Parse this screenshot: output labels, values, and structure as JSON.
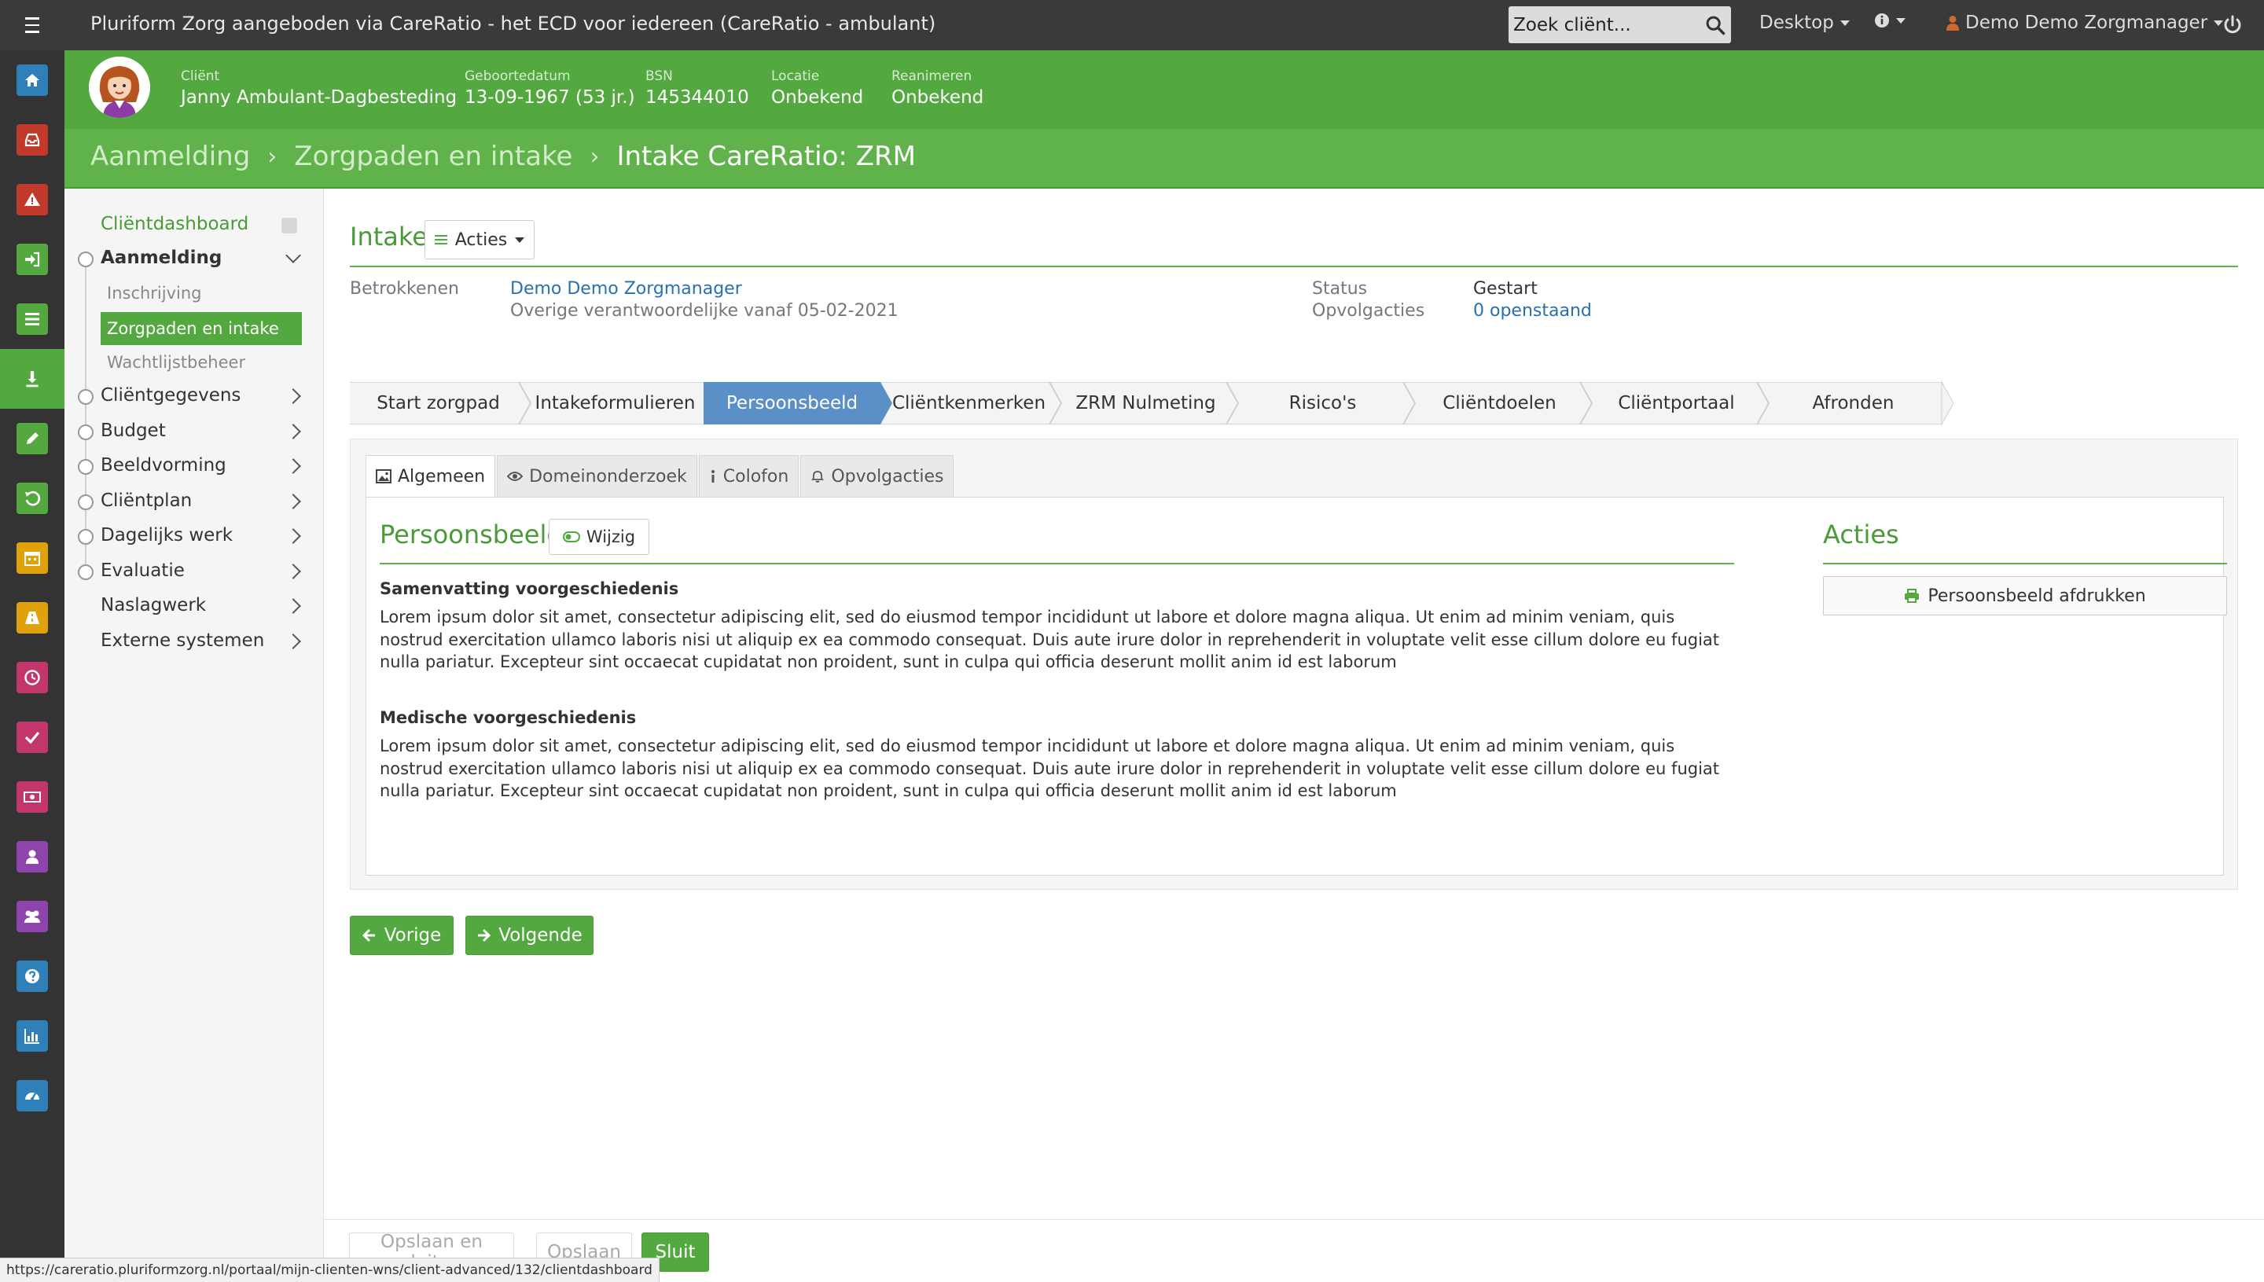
{
  "app": {
    "title": "Pluriform Zorg aangeboden via CareRatio - het ECD voor iedereen  (CareRatio - ambulant)"
  },
  "topbar": {
    "search_placeholder": "Zoek cliënt...",
    "desktop_label": "Desktop",
    "user_label": "Demo Demo Zorgmanager"
  },
  "rail": {
    "items": [
      {
        "icon": "home-icon",
        "color": "#2f7fb8"
      },
      {
        "icon": "inbox-icon",
        "color": "#c0392b"
      },
      {
        "icon": "warning-icon",
        "color": "#c0392b"
      },
      {
        "icon": "sign-in-icon",
        "color": "#53a83f"
      },
      {
        "icon": "list-icon",
        "color": "#53a83f"
      },
      {
        "icon": "client-icon",
        "color": "#53a83f",
        "active": true
      },
      {
        "icon": "pencil-icon",
        "color": "#53a83f"
      },
      {
        "icon": "refresh-icon",
        "color": "#53a83f"
      },
      {
        "icon": "calendar-icon",
        "color": "#e0a10b"
      },
      {
        "icon": "road-icon",
        "color": "#e0a10b"
      },
      {
        "icon": "clock-icon",
        "color": "#c2366b"
      },
      {
        "icon": "check-icon",
        "color": "#c2366b"
      },
      {
        "icon": "money-icon",
        "color": "#c2366b"
      },
      {
        "icon": "user-icon",
        "color": "#8e44ad"
      },
      {
        "icon": "users-icon",
        "color": "#8e44ad"
      },
      {
        "icon": "question-icon",
        "color": "#2f7fb8"
      },
      {
        "icon": "bar-chart-icon",
        "color": "#2f7fb8"
      },
      {
        "icon": "dashboard-icon",
        "color": "#2f7fb8"
      }
    ]
  },
  "client": {
    "fields": [
      {
        "label": "Cliënt",
        "value": "Janny Ambulant-Dagbesteding"
      },
      {
        "label": "Geboortedatum",
        "value": "13-09-1967 (53 jr.)"
      },
      {
        "label": "BSN",
        "value": "145344010"
      },
      {
        "label": "Locatie",
        "value": "Onbekend"
      },
      {
        "label": "Reanimeren",
        "value": "Onbekend"
      }
    ]
  },
  "breadcrumb": {
    "items": [
      "Aanmelding",
      "Zorgpaden en intake"
    ],
    "current": "Intake CareRatio: ZRM",
    "separator": "›"
  },
  "leftnav": {
    "dashboard": "Cliëntdashboard",
    "main": [
      {
        "label": "Aanmelding",
        "expanded": true
      },
      {
        "label": "Cliëntgegevens"
      },
      {
        "label": "Budget"
      },
      {
        "label": "Beeldvorming"
      },
      {
        "label": "Cliëntplan"
      },
      {
        "label": "Dagelijks werk"
      },
      {
        "label": "Evaluatie"
      },
      {
        "label": "Naslagwerk"
      },
      {
        "label": "Externe systemen"
      }
    ],
    "sub": [
      {
        "label": "Inschrijving"
      },
      {
        "label": "Zorgpaden en intake",
        "active": true
      },
      {
        "label": "Wachtlijstbeheer"
      }
    ]
  },
  "intake": {
    "title": "Intake",
    "acties_label": "Acties",
    "betrokkenen_label": "Betrokkenen",
    "betrokkene_name": "Demo Demo Zorgmanager",
    "betrokkene_role": "Overige verantwoordelijke vanaf 05-02-2021",
    "status_label": "Status",
    "status_value": "Gestart",
    "opvolgacties_label": "Opvolgacties",
    "opvolgacties_value": "0 openstaand"
  },
  "steps": [
    {
      "label": "Start zorgpad"
    },
    {
      "label": "Intakeformulieren"
    },
    {
      "label": "Persoonsbeeld",
      "active": true
    },
    {
      "label": "Cliëntkenmerken"
    },
    {
      "label": "ZRM Nulmeting"
    },
    {
      "label": "Risico's"
    },
    {
      "label": "Cliëntdoelen"
    },
    {
      "label": "Cliëntportaal"
    },
    {
      "label": "Afronden"
    }
  ],
  "tabs": [
    {
      "label": "Algemeen",
      "icon": "picture-icon",
      "active": true
    },
    {
      "label": "Domeinonderzoek",
      "icon": "eye-icon"
    },
    {
      "label": "Colofon",
      "icon": "info-icon"
    },
    {
      "label": "Opvolgacties",
      "icon": "bell-icon"
    }
  ],
  "persoonsbeeld": {
    "title": "Persoonsbeeld",
    "wijzig_label": "Wijzig",
    "sections": [
      {
        "heading": "Samenvatting voorgeschiedenis",
        "text": "Lorem ipsum dolor sit amet, consectetur adipiscing elit, sed do eiusmod tempor incididunt ut labore et dolore magna aliqua. Ut enim ad minim veniam, quis nostrud exercitation ullamco laboris nisi ut aliquip ex ea commodo consequat. Duis aute irure dolor in reprehenderit in voluptate velit esse cillum dolore eu fugiat nulla pariatur. Excepteur sint occaecat cupidatat non proident, sunt in culpa qui officia deserunt mollit anim id est laborum"
      },
      {
        "heading": "Medische voorgeschiedenis",
        "text": "Lorem ipsum dolor sit amet, consectetur adipiscing elit, sed do eiusmod tempor incididunt ut labore et dolore magna aliqua. Ut enim ad minim veniam, quis nostrud exercitation ullamco laboris nisi ut aliquip ex ea commodo consequat. Duis aute irure dolor in reprehenderit in voluptate velit esse cillum dolore eu fugiat nulla pariatur. Excepteur sint occaecat cupidatat non proident, sunt in culpa qui officia deserunt mollit anim id est laborum"
      }
    ]
  },
  "acties_panel": {
    "title": "Acties",
    "print_label": "Persoonsbeeld afdrukken"
  },
  "wizard_nav": {
    "prev_label": "Vorige",
    "next_label": "Volgende"
  },
  "footer": {
    "save_close_label": "Opslaan en sluiten",
    "save_label": "Opslaan",
    "close_label": "Sluit"
  },
  "statusbar": {
    "url": "https://careratio.pluriformzorg.nl/portaal/mijn-clienten-wns/client-advanced/132/clientdashboard"
  },
  "colors": {
    "brand_green": "#53a83f",
    "breadcrumb_green": "#60b24a",
    "active_step_blue": "#5b8fc7",
    "link_blue": "#2a6fb0",
    "topbar": "#3a3a3a"
  }
}
